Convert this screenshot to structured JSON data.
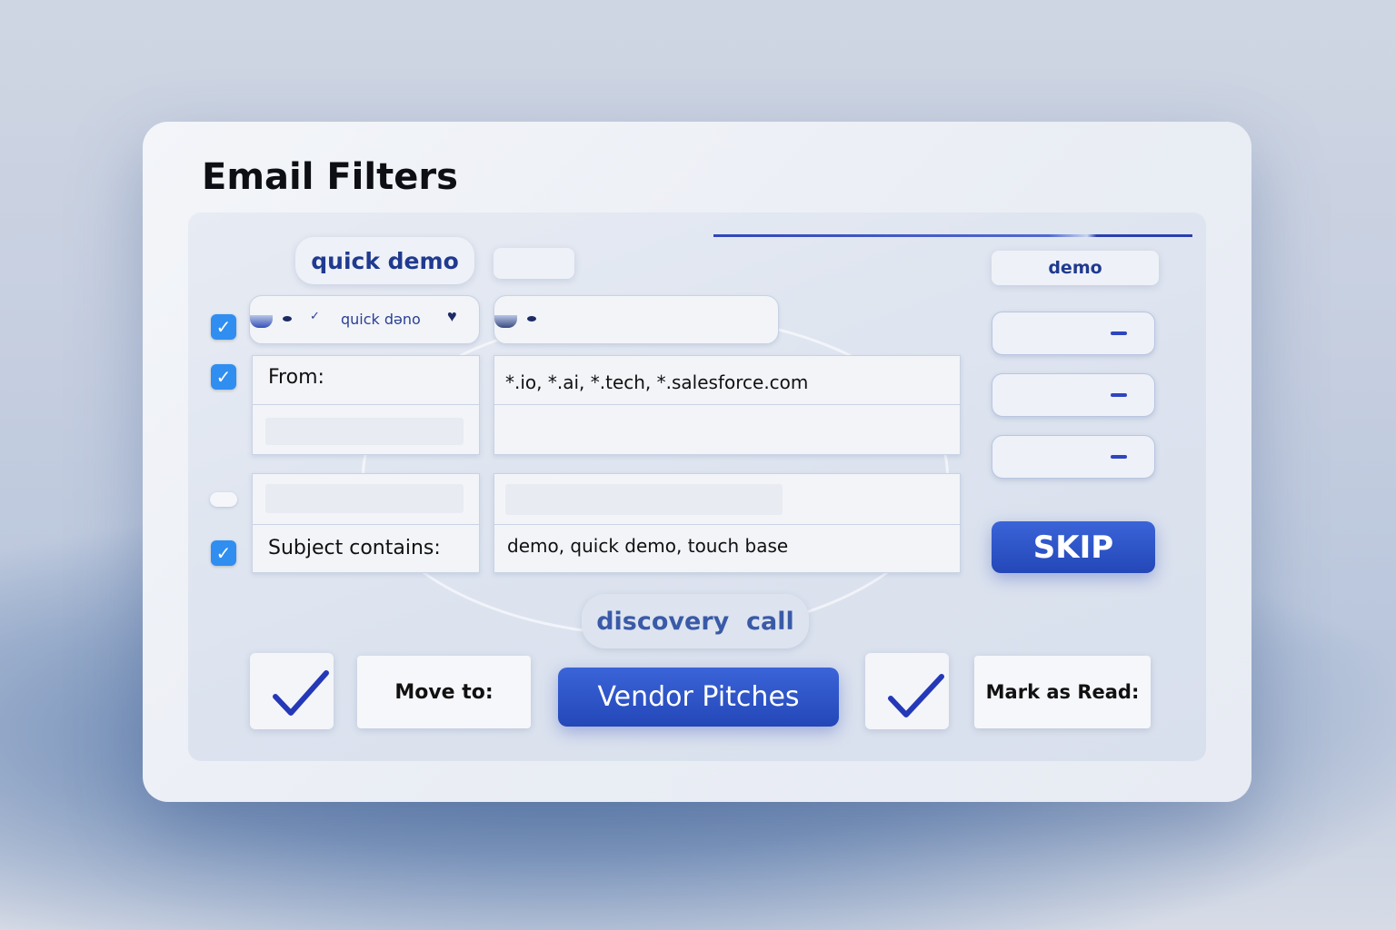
{
  "app": {
    "title": "Email Filters"
  },
  "keyword_chips": {
    "quick_demo": "quick demo",
    "demo": "demo",
    "discovery_call": "discovery  call"
  },
  "rule_row": {
    "chip_text": "quick dəno"
  },
  "conditions": {
    "from_label": "From:",
    "from_value": "*.io, *.ai, *.tech, *.salesforce.com",
    "subject_label": "Subject contains:",
    "subject_value": "demo, quick demo, touch base"
  },
  "actions": {
    "skip_label": "SKIP",
    "move_to_label": "Move to:",
    "move_to_folder": "Vendor Pitches",
    "mark_as_read_label": "Mark as Read:"
  },
  "colors": {
    "accent": "#2447b8",
    "checkbox": "#2f8ef0",
    "chip_text": "#1f3a8f"
  },
  "icons": {
    "check": "checkmark-icon",
    "heart": "heart-icon",
    "chevron": "chevron-down-icon",
    "minus": "minus-icon"
  }
}
